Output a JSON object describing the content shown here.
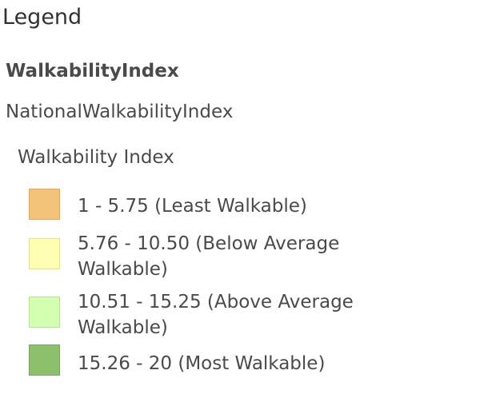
{
  "legend": {
    "title": "Legend",
    "layer_title": "WalkabilityIndex",
    "sublayer_title": "NationalWalkabilityIndex",
    "field_title": "Walkability Index",
    "items": [
      {
        "label": "1 - 5.75 (Least Walkable)",
        "color": "#f4c37a"
      },
      {
        "label": "5.76 - 10.50 (Below Average Walkable)",
        "color": "#ffffb3"
      },
      {
        "label": "10.51 - 15.25 (Above Average Walkable)",
        "color": "#d2ffb0"
      },
      {
        "label": "15.26 - 20 (Most Walkable)",
        "color": "#8cc06c"
      }
    ]
  }
}
